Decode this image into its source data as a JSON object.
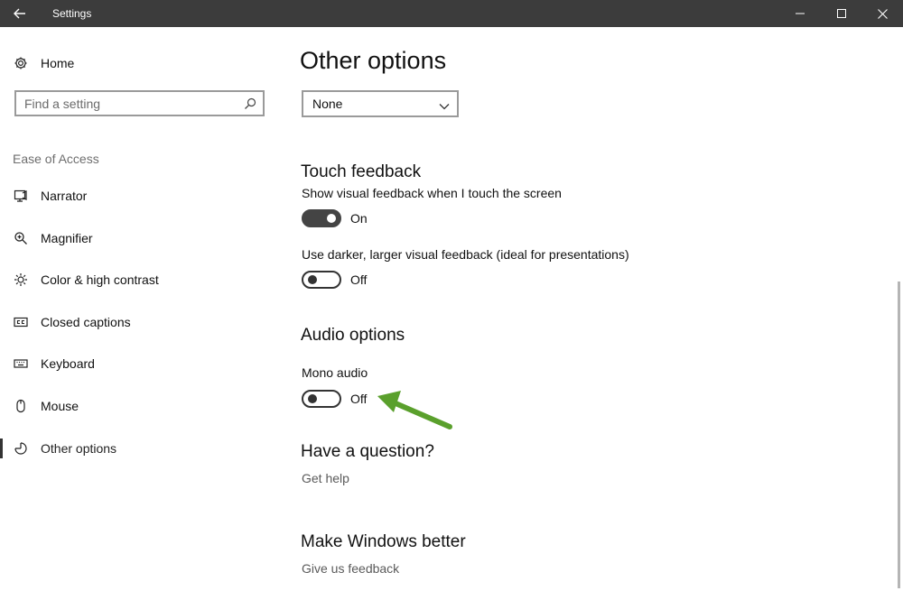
{
  "window": {
    "title": "Settings",
    "back_icon": "back-arrow-icon",
    "controls": [
      "minimize-icon",
      "maximize-icon",
      "close-icon"
    ]
  },
  "sidebar": {
    "home_label": "Home",
    "search_placeholder": "Find a setting",
    "section_label": "Ease of Access",
    "items": [
      {
        "label": "Narrator",
        "icon": "narrator-icon"
      },
      {
        "label": "Magnifier",
        "icon": "magnifier-icon"
      },
      {
        "label": "Color & high contrast",
        "icon": "brightness-icon"
      },
      {
        "label": "Closed captions",
        "icon": "closed-captions-icon"
      },
      {
        "label": "Keyboard",
        "icon": "keyboard-icon"
      },
      {
        "label": "Mouse",
        "icon": "mouse-icon"
      },
      {
        "label": "Other options",
        "icon": "other-options-icon",
        "active": true
      }
    ]
  },
  "main": {
    "title": "Other options",
    "dropdown_value": "None",
    "touch_feedback": {
      "heading": "Touch feedback",
      "visual_feedback_label": "Show visual feedback when I touch the screen",
      "visual_feedback_state": "On",
      "darker_feedback_label": "Use darker, larger visual feedback (ideal for presentations)",
      "darker_feedback_state": "Off"
    },
    "audio_options": {
      "heading": "Audio options",
      "mono_audio_label": "Mono audio",
      "mono_audio_state": "Off"
    },
    "question": {
      "heading": "Have a question?",
      "link": "Get help"
    },
    "feedback": {
      "heading": "Make Windows better",
      "link": "Give us feedback"
    }
  },
  "colors": {
    "titlebar": "#3c3c3c",
    "annotation_arrow": "#5aa02c"
  }
}
